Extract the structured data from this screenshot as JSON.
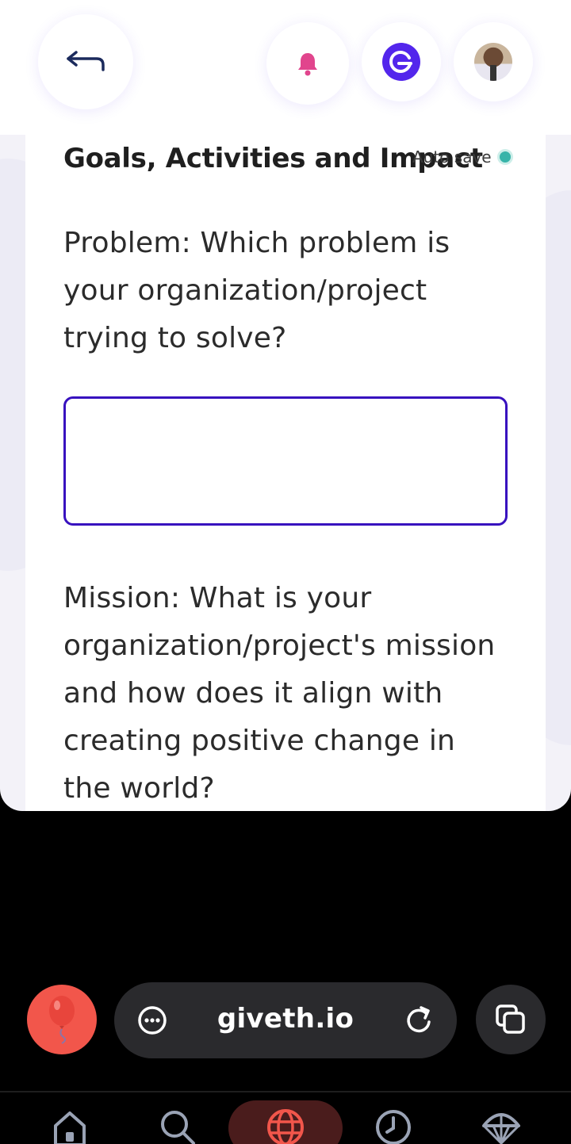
{
  "header": {
    "back_label": "Back",
    "notifications_label": "Notifications",
    "wallet_label": "Wallet",
    "profile_label": "Profile"
  },
  "form": {
    "section_title": "Goals, Activities and Impact",
    "autosave_label": "Auto save",
    "autosave_color": "#37b4a9",
    "question_problem": "Problem: Which problem is your organization/project trying to solve?",
    "problem_value": "",
    "question_mission": "Mission: What is your organization/project's mission and how does it align with creating positive change in the world?",
    "input_border_color": "#3811bf"
  },
  "browser": {
    "url": "giveth.io",
    "icons": [
      "balloon-icon",
      "menu-dots-icon",
      "reload-icon",
      "tabs-icon"
    ]
  },
  "bottom_nav": {
    "items": [
      {
        "icon": "home-icon"
      },
      {
        "icon": "search-icon"
      },
      {
        "icon": "globe-icon",
        "active": true
      },
      {
        "icon": "history-icon"
      },
      {
        "icon": "airdrop-icon"
      }
    ]
  }
}
